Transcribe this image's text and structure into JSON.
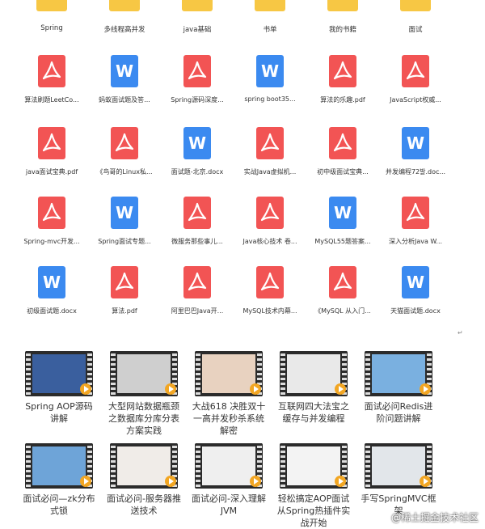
{
  "folders": [
    "Spring",
    "多线程高并发",
    "java基础",
    "书单",
    "我的书籍",
    "面试"
  ],
  "files": [
    [
      {
        "type": "pdf",
        "name": "算法刷题LeetCo..."
      },
      {
        "type": "doc",
        "name": "蚂蚁面试题及答..."
      },
      {
        "type": "pdf",
        "name": "Spring源码深度..."
      },
      {
        "type": "doc",
        "name": "spring boot35..."
      },
      {
        "type": "pdf",
        "name": "算法的乐趣.pdf"
      },
      {
        "type": "pdf",
        "name": "JavaScript权威..."
      }
    ],
    [
      {
        "type": "pdf",
        "name": "java面试宝典.pdf"
      },
      {
        "type": "pdf",
        "name": "《鸟哥的Linux私..."
      },
      {
        "type": "doc",
        "name": "面试题-北京.docx"
      },
      {
        "type": "pdf",
        "name": "实战Java虚拟机..."
      },
      {
        "type": "pdf",
        "name": "初中级面试宝典..."
      },
      {
        "type": "doc",
        "name": "并发编程72발.doc..."
      }
    ],
    [
      {
        "type": "pdf",
        "name": "Spring-mvc开发..."
      },
      {
        "type": "doc",
        "name": "Spring面试专题..."
      },
      {
        "type": "pdf",
        "name": "微服务那些事儿..."
      },
      {
        "type": "pdf",
        "name": "Java核心技术 卷..."
      },
      {
        "type": "doc",
        "name": "MySQL55题答案..."
      },
      {
        "type": "pdf",
        "name": "深入分析Java  W..."
      }
    ],
    [
      {
        "type": "doc",
        "name": "初级面试题.docx"
      },
      {
        "type": "pdf",
        "name": "算法.pdf"
      },
      {
        "type": "pdf",
        "name": "阿里巴巴Java开..."
      },
      {
        "type": "pdf",
        "name": "MySQL技术内幕..."
      },
      {
        "type": "pdf",
        "name": "《MySQL 从入门..."
      },
      {
        "type": "doc",
        "name": "天猫面试题.docx"
      }
    ]
  ],
  "videos": [
    [
      {
        "title": "Spring AOP源码讲解",
        "screen": "#3a5f9e"
      },
      {
        "title": "大型网站数据瓶颈之数据库分库分表方案实践",
        "screen": "#cfcfcf"
      },
      {
        "title": "大战618 决胜双十一高并发秒杀系统解密",
        "screen": "#e8d2c0"
      },
      {
        "title": "互联网四大法宝之缓存与并发编程",
        "screen": "#e9e9e9"
      },
      {
        "title": "面试必问Redis进阶问题讲解",
        "screen": "#7ab0e0"
      }
    ],
    [
      {
        "title": "面试必问—zk分布式锁",
        "screen": "#6ea4d8"
      },
      {
        "title": "面试必问-服务器推送技术",
        "screen": "#f0ece8"
      },
      {
        "title": "面试必问-深入理解JVM",
        "screen": "#efefef"
      },
      {
        "title": "轻松搞定AOP面试从Spring热插件实战开始",
        "screen": "#f3f3f3"
      },
      {
        "title": "手写SpringMVC框架",
        "screen": "#e2e6ea"
      }
    ]
  ],
  "enter_mark": "↵",
  "watermark": "@稀土掘金技术社区",
  "colors": {
    "pdf": "#f25454",
    "doc": "#3b8af0",
    "folder": "#f7c744",
    "play": "#f2a623"
  },
  "icons": {
    "pdf": "acrobat-pdf-icon",
    "doc": "word-doc-icon",
    "folder": "folder-icon",
    "video": "video-file-icon"
  }
}
